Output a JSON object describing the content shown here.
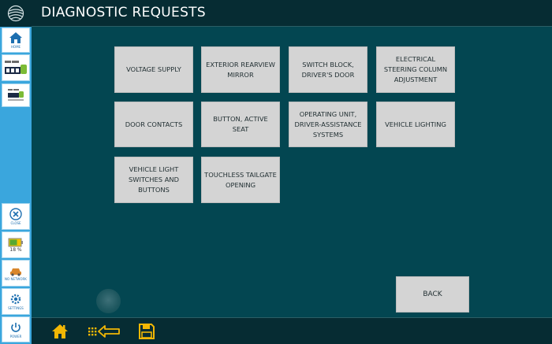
{
  "window": {
    "title": "DIAGNOSTIC REQUESTS"
  },
  "sidebar": {
    "home_label": "HOME",
    "close_label": "CLOSE",
    "battery_text": "18 %",
    "network_label": "NO NETWORK",
    "settings_label": "SETTINGS",
    "power_label": "POWER"
  },
  "requests": [
    {
      "label": "VOLTAGE SUPPLY"
    },
    {
      "label": "EXTERIOR REARVIEW MIRROR"
    },
    {
      "label": "SWITCH BLOCK, DRIVER'S DOOR"
    },
    {
      "label": "ELECTRICAL STEERING COLUMN ADJUSTMENT"
    },
    {
      "label": "DOOR CONTACTS"
    },
    {
      "label": "BUTTON, ACTIVE SEAT"
    },
    {
      "label": "OPERATING UNIT, DRIVER-ASSISTANCE SYSTEMS"
    },
    {
      "label": "VEHICLE LIGHTING"
    },
    {
      "label": "VEHICLE LIGHT SWITCHES AND BUTTONS"
    },
    {
      "label": "TOUCHLESS TAILGATE OPENING"
    }
  ],
  "actions": {
    "back_label": "BACK"
  },
  "icons": {
    "home": "home-icon",
    "back": "back-arrow-icon",
    "save": "save-icon"
  },
  "colors": {
    "background": "#034651",
    "bar": "#062c33",
    "sidebar": "#3aa6dd",
    "button": "#d4d4d4",
    "accent": "#f2b705"
  }
}
